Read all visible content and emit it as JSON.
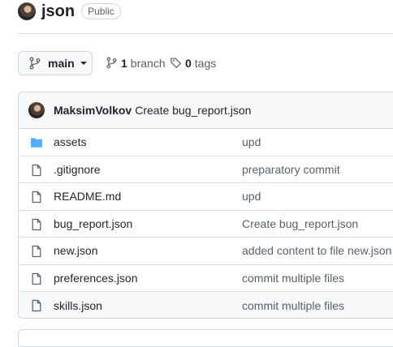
{
  "repo": {
    "name": "json",
    "visibility": "Public"
  },
  "branch": {
    "current": "main",
    "count": "1",
    "count_label": "branch"
  },
  "tags": {
    "count": "0",
    "label": "tags"
  },
  "latest_commit": {
    "author": "MaksimVolkov",
    "message": "Create bug_report.json"
  },
  "files": [
    {
      "type": "folder",
      "name": "assets",
      "message": "upd"
    },
    {
      "type": "file",
      "name": ".gitignore",
      "message": "preparatory commit"
    },
    {
      "type": "file",
      "name": "README.md",
      "message": "upd"
    },
    {
      "type": "file",
      "name": "bug_report.json",
      "message": "Create bug_report.json"
    },
    {
      "type": "file",
      "name": "new.json",
      "message": "added content to file new.json"
    },
    {
      "type": "file",
      "name": "preferences.json",
      "message": "commit multiple files"
    },
    {
      "type": "file",
      "name": "skills.json",
      "message": "commit multiple files"
    }
  ],
  "colors": {
    "folder": "#54aeff",
    "icon": "#57606a",
    "border": "#d0d7de"
  }
}
